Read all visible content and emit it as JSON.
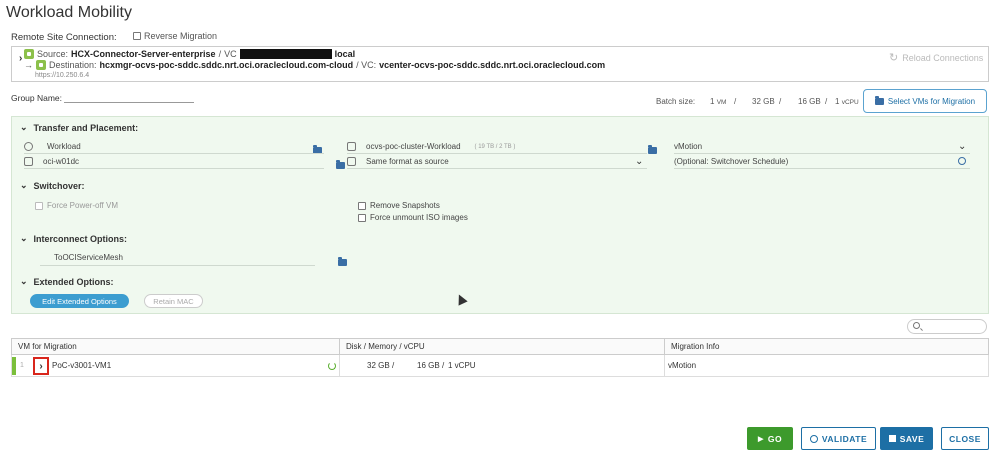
{
  "page": {
    "title": "Workload Mobility"
  },
  "remote": {
    "label": "Remote Site Connection:",
    "reverse_migration": "Reverse Migration",
    "source_label": "Source:",
    "source_name": "HCX-Connector-Server-enterprise",
    "sep": "/",
    "vc_label": "VC",
    "vc_suffix": "local",
    "dest_label": "Destination:",
    "dest_name": "hcxmgr-ocvs-poc-sddc.sddc.nrt.oci.oraclecloud.com-cloud",
    "dest_vc_label": "/  VC:",
    "dest_vc_name": "vcenter-ocvs-poc-sddc.sddc.nrt.oci.oraclecloud.com",
    "url": "https://10.250.6.4",
    "reload": "Reload Connections"
  },
  "group": {
    "label": "Group Name:"
  },
  "batch": {
    "label": "Batch size:",
    "vm_count": "1",
    "vm_unit": "VM",
    "disk": "32 GB",
    "mem": "16 GB",
    "cpu_count": "1",
    "cpu_unit": "vCPU",
    "slash": "/",
    "select_button": "Select VMs for Migration"
  },
  "transfer": {
    "title": "Transfer and Placement:",
    "folder": "Workload",
    "cluster": "ocvs-poc-cluster-Workload",
    "cluster_cap": "( 19 TB / 2 TB )",
    "method": "vMotion",
    "datacenter": "oci-w01dc",
    "format": "Same format as source",
    "schedule": "(Optional: Switchover Schedule)"
  },
  "switchover": {
    "title": "Switchover:",
    "force_poweroff": "Force Power-off VM",
    "remove_snapshots": "Remove Snapshots",
    "force_unmount": "Force unmount ISO images"
  },
  "interconnect": {
    "title": "Interconnect Options:",
    "mesh": "ToOCIServiceMesh"
  },
  "extended": {
    "title": "Extended Options:",
    "edit": "Edit Extended Options",
    "retain_mac": "Retain MAC"
  },
  "grid": {
    "headers": [
      "VM for Migration",
      "Disk / Memory / vCPU",
      "Migration Info"
    ],
    "row": {
      "index": "1",
      "vm": "PoC-v3001-VM1",
      "disk": "32 GB",
      "slash": "/",
      "mem": "16 GB",
      "cpu": "1 vCPU",
      "info": "vMotion"
    }
  },
  "footer": {
    "go": "GO",
    "validate": "VALIDATE",
    "save": "SAVE",
    "close": "CLOSE"
  },
  "colors": {
    "accent": "#1d6fa5",
    "go": "#3d9a2c",
    "panel_bg": "#f0f9ef",
    "highlight": "#d9261c"
  }
}
